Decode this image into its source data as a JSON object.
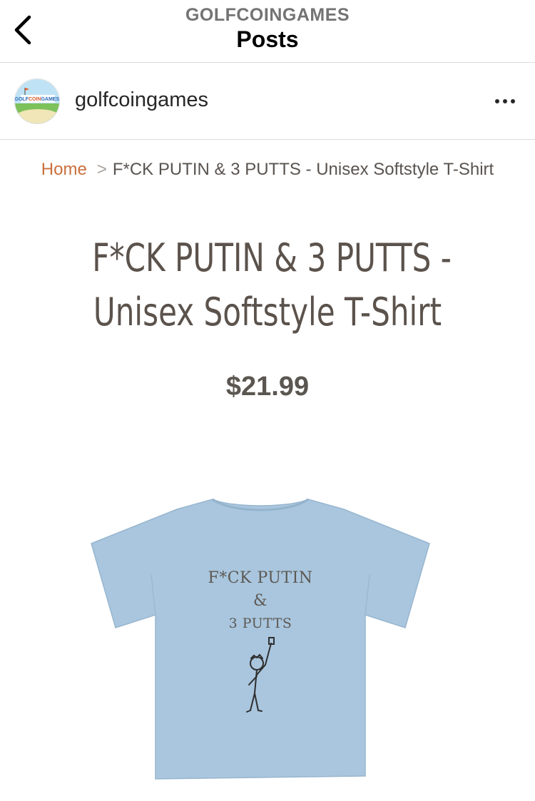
{
  "header": {
    "account_caption": "GOLFCOINGAMES",
    "title": "Posts",
    "back_icon": "chevron-left-icon"
  },
  "post": {
    "username": "golfcoingames",
    "avatar_text": "GOLFCOINGAMES!",
    "more_icon": "more-horizontal-icon"
  },
  "product": {
    "breadcrumb_home": "Home",
    "breadcrumb_separator": ">",
    "breadcrumb_current": "F*CK PUTIN & 3 PUTTS - Unisex Softstyle T-Shirt",
    "title_line1": "F*CK PUTIN & 3 PUTTS -",
    "title_line2": "Unisex Softstyle T-Shirt",
    "price": "$21.99",
    "shirt_color": "#a9c6de",
    "shirt_print_line1": "F*CK PUTIN",
    "shirt_print_line2": "&",
    "shirt_print_line3": "3 PUTTS"
  },
  "colors": {
    "link_accent": "#c9703c",
    "title_text": "#5b524c",
    "divider": "#dbdbdb"
  }
}
